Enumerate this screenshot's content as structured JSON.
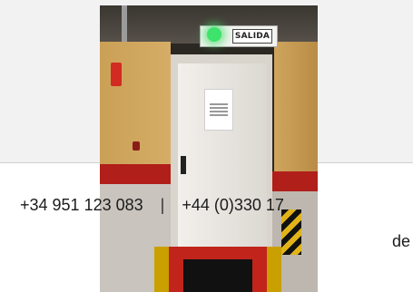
{
  "photo": {
    "exit_sign_text": "SALIDA",
    "colors": {
      "exit_light": "#3de36a",
      "wall": "#d6ad66",
      "stripe": "#b01f1a",
      "door": "#f2f0ec"
    }
  },
  "contact": {
    "phone_1": "+34 951 123 083",
    "separator": "|",
    "phone_2": "+44 (0)330 17"
  },
  "continuation": {
    "text": "de"
  }
}
